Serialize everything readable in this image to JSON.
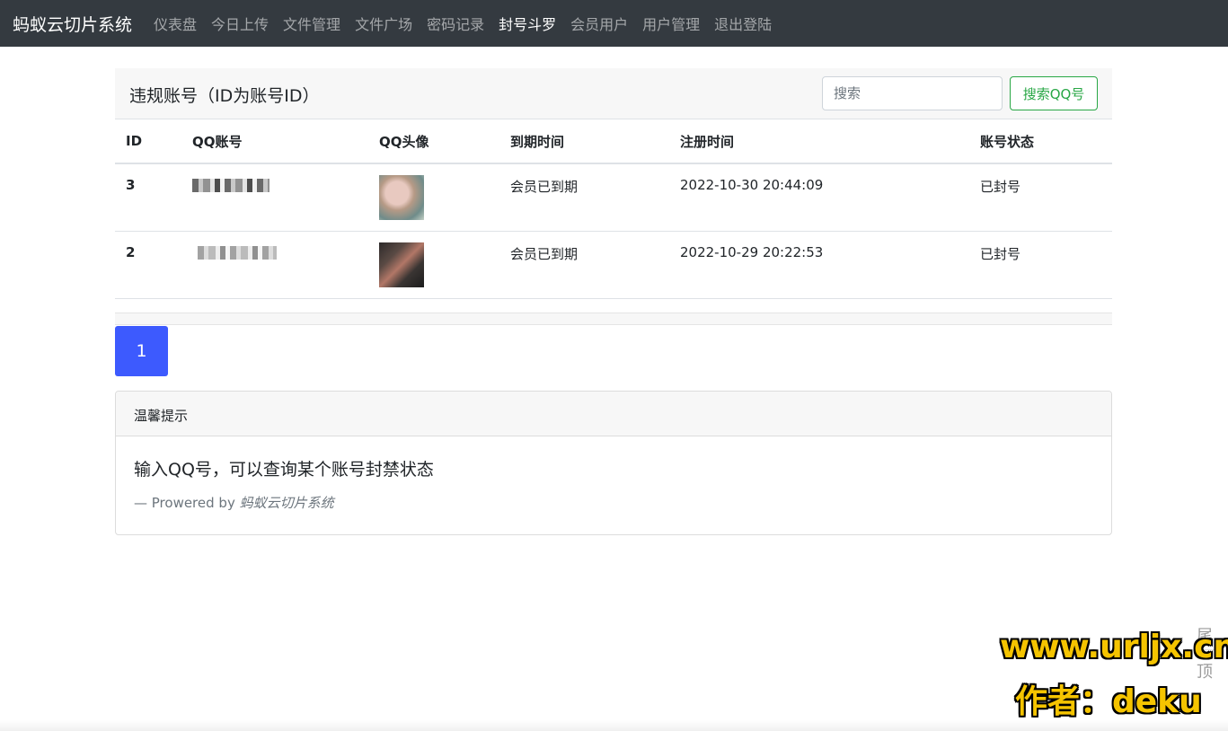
{
  "navbar": {
    "brand": "蚂蚁云切片系统",
    "items": [
      {
        "label": "仪表盘",
        "active": false
      },
      {
        "label": "今日上传",
        "active": false
      },
      {
        "label": "文件管理",
        "active": false
      },
      {
        "label": "文件广场",
        "active": false
      },
      {
        "label": "密码记录",
        "active": false
      },
      {
        "label": "封号斗罗",
        "active": true
      },
      {
        "label": "会员用户",
        "active": false
      },
      {
        "label": "用户管理",
        "active": false
      },
      {
        "label": "退出登陆",
        "active": false
      }
    ]
  },
  "panel": {
    "title": "违规账号（ID为账号ID）",
    "search_placeholder": "搜索",
    "search_button": "搜索QQ号"
  },
  "table": {
    "headers": [
      "ID",
      "QQ账号",
      "QQ头像",
      "到期时间",
      "注册时间",
      "账号状态"
    ],
    "rows": [
      {
        "id": "3",
        "expire": "会员已到期",
        "registered": "2022-10-30 20:44:09",
        "status": "已封号"
      },
      {
        "id": "2",
        "expire": "会员已到期",
        "registered": "2022-10-29 20:22:53",
        "status": "已封号"
      }
    ]
  },
  "pagination": {
    "current": "1"
  },
  "tips": {
    "header": "温馨提示",
    "text": "输入QQ号，可以查询某个账号封禁状态",
    "footer_prefix": "— Prowered by ",
    "footer_brand": "蚂蚁云切片系统"
  },
  "side": {
    "bottom": "尾",
    "top": "顶"
  },
  "watermark": {
    "line1": "www.urljx.cn",
    "line2": "作者：deku"
  }
}
